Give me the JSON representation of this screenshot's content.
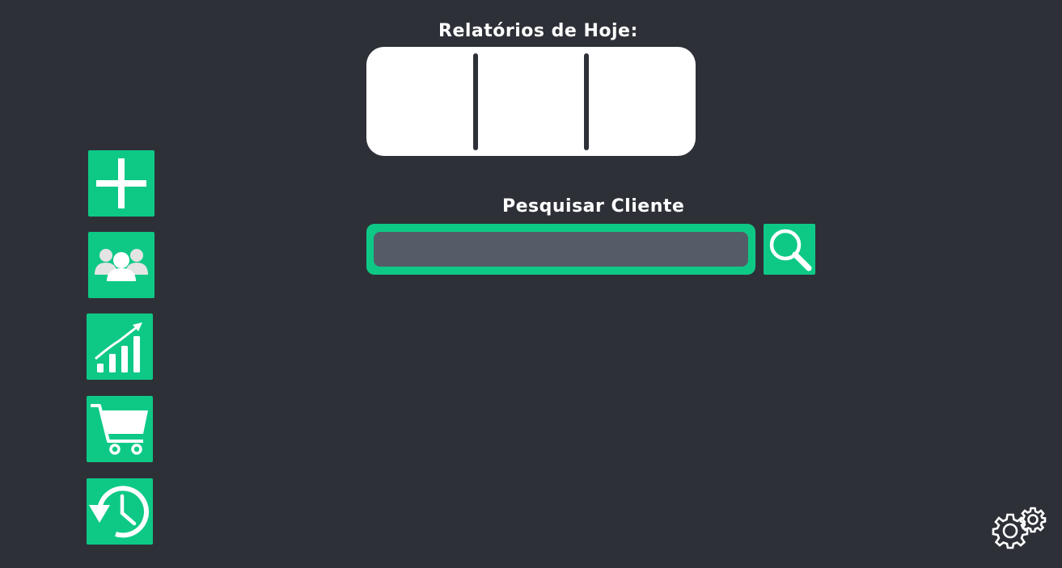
{
  "reports": {
    "title": "Relatórios de Hoje:",
    "cells": [
      "",
      "",
      ""
    ]
  },
  "search": {
    "title": "Pesquisar Cliente",
    "value": "",
    "placeholder": "",
    "button_icon": "magnifier-icon"
  },
  "sidebar": {
    "items": [
      {
        "name": "add",
        "icon": "plus-icon"
      },
      {
        "name": "clients",
        "icon": "users-icon"
      },
      {
        "name": "reports",
        "icon": "growth-chart-icon"
      },
      {
        "name": "sales",
        "icon": "shopping-cart-icon"
      },
      {
        "name": "history",
        "icon": "history-clock-icon"
      }
    ]
  },
  "settings": {
    "icon": "gears-icon"
  },
  "colors": {
    "background": "#2e3038",
    "accent": "#0ec986",
    "input": "#545c68",
    "panel": "#ffffff"
  }
}
